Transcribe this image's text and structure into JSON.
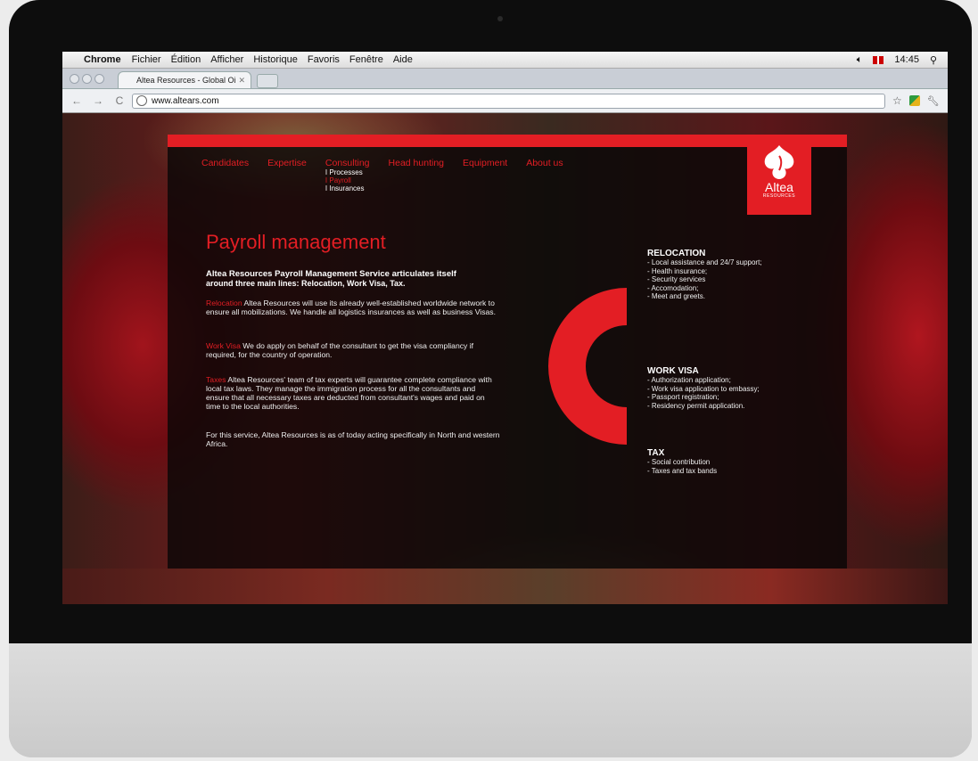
{
  "menubar": {
    "app": "Chrome",
    "menus": [
      "Fichier",
      "Édition",
      "Afficher",
      "Historique",
      "Favoris",
      "Fenêtre",
      "Aide"
    ],
    "time": "14:45"
  },
  "browser": {
    "tab_title": "Altea Resources - Global Oi",
    "url": "www.altears.com"
  },
  "site": {
    "nav": [
      "Candidates",
      "Expertise",
      "Consulting",
      "Head hunting",
      "Equipment",
      "About us"
    ],
    "submenu": [
      "I Processes",
      "I Payroll",
      "I Insurances"
    ],
    "logo": {
      "name": "Altea",
      "sub": "RESOURCES"
    },
    "title": "Payroll management",
    "intro_line1": "Altea Resources Payroll Management Service articulates itself",
    "intro_line2": "around three main lines: Relocation, Work Visa, Tax.",
    "paragraphs": [
      {
        "keyword": "Relocation",
        "text": " Altea Resources will use its already well-established worldwide network to ensure all mobilizations. We handle all logistics insurances as well as business Visas."
      },
      {
        "keyword": "Work Visa",
        "text": " We do apply on behalf of the consultant to get the visa compliancy if required, for the country of operation."
      },
      {
        "keyword": "Taxes",
        "text": " Altea Resources' team of tax experts will guarantee complete compliance with local tax laws. They manage the immigration process for all the consultants and ensure that all necessary taxes are deducted from consultant's wages and paid on time to the local authorities."
      }
    ],
    "footer_note": "For this service, Altea Resources is as of today acting specifically in North and western Africa.",
    "sections": [
      {
        "heading": "RELOCATION",
        "items": [
          "- Local assistance and 24/7 support;",
          "- Health insurance;",
          "- Security services",
          "- Accomodation;",
          "- Meet and greets."
        ]
      },
      {
        "heading": "WORK VISA",
        "items": [
          "- Authorization application;",
          "- Work visa application to embassy;",
          "- Passport registration;",
          "- Residency permit application."
        ]
      },
      {
        "heading": "TAX",
        "items": [
          "- Social contribution",
          "- Taxes and tax bands"
        ]
      }
    ]
  },
  "colors": {
    "brand_red": "#e31e24"
  }
}
